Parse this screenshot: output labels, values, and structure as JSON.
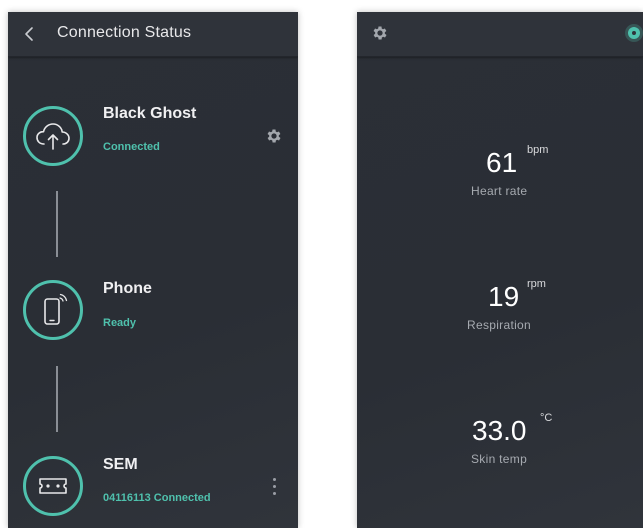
{
  "connection_screen": {
    "title": "Connection Status",
    "nodes": [
      {
        "name": "Black Ghost",
        "status": "Connected",
        "icon": "cloud-upload-icon"
      },
      {
        "name": "Phone",
        "status": "Ready",
        "icon": "smartphone-icon"
      },
      {
        "name": "SEM",
        "status": "04116113 Connected",
        "icon": "sensor-device-icon"
      }
    ]
  },
  "vitals_screen": {
    "metrics": [
      {
        "value": "61",
        "unit": "bpm",
        "label": "Heart rate"
      },
      {
        "value": "19",
        "unit": "rpm",
        "label": "Respiration"
      },
      {
        "value": "33.0",
        "unit": "°C",
        "label": "Skin temp"
      }
    ]
  },
  "colors": {
    "accent": "#4fc1ad",
    "background": "#2b2f36",
    "topbar": "#2f333a"
  }
}
